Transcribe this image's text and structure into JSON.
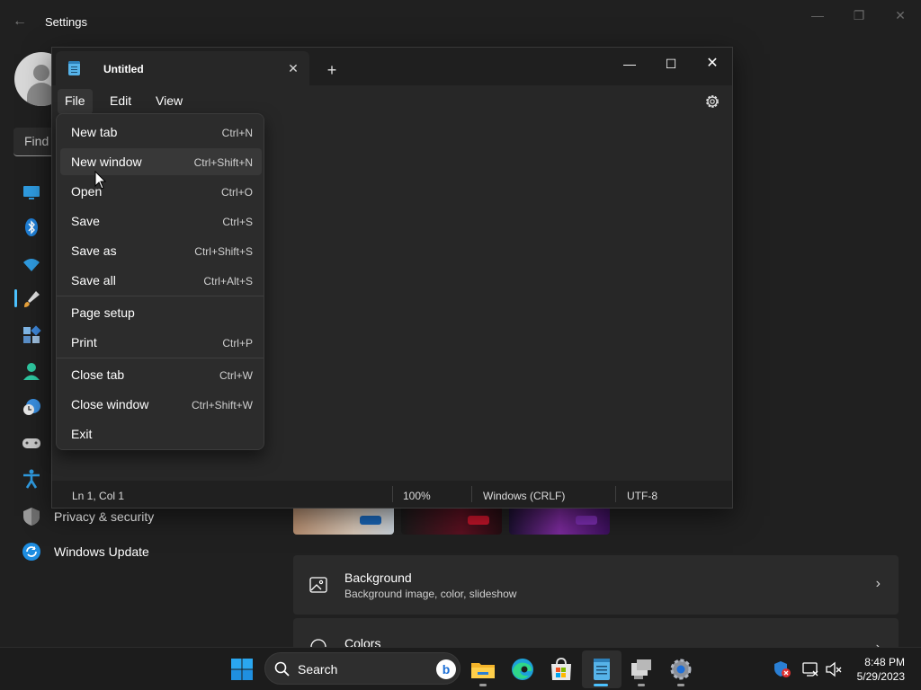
{
  "settings": {
    "title": "Settings",
    "search_placeholder": "Find",
    "nav": [
      {
        "label": "Privacy & security",
        "icon": "shield-icon"
      },
      {
        "label": "Windows Update",
        "icon": "windows-update-icon"
      }
    ],
    "cards": [
      {
        "title": "Background",
        "subtitle": "Background image, color, slideshow",
        "icon": "picture-icon"
      },
      {
        "title": "Colors",
        "subtitle": "",
        "icon": "palette-icon"
      }
    ]
  },
  "notepad": {
    "tab_title": "Untitled",
    "new_tab_glyph": "+",
    "menus": [
      "File",
      "Edit",
      "View"
    ],
    "active_menu": "File",
    "file_menu": [
      {
        "label": "New tab",
        "shortcut": "Ctrl+N"
      },
      {
        "label": "New window",
        "shortcut": "Ctrl+Shift+N"
      },
      {
        "label": "Open",
        "shortcut": "Ctrl+O"
      },
      {
        "label": "Save",
        "shortcut": "Ctrl+S"
      },
      {
        "label": "Save as",
        "shortcut": "Ctrl+Shift+S"
      },
      {
        "label": "Save all",
        "shortcut": "Ctrl+Alt+S"
      },
      {
        "label": "Page setup",
        "shortcut": ""
      },
      {
        "label": "Print",
        "shortcut": "Ctrl+P"
      },
      {
        "label": "Close tab",
        "shortcut": "Ctrl+W"
      },
      {
        "label": "Close window",
        "shortcut": "Ctrl+Shift+W"
      },
      {
        "label": "Exit",
        "shortcut": ""
      }
    ],
    "hovered_item": "New window",
    "status": {
      "position": "Ln 1, Col 1",
      "zoom": "100%",
      "line_ending": "Windows (CRLF)",
      "encoding": "UTF-8"
    }
  },
  "taskbar": {
    "search_label": "Search",
    "pinned": [
      "start-icon",
      "search",
      "file-explorer-icon",
      "edge-icon",
      "store-icon",
      "notepad-icon",
      "remote-desktop-icon",
      "settings-icon"
    ],
    "time": "8:48 PM",
    "date": "5/29/2023"
  },
  "colors": {
    "accent": "#4cc2ff",
    "background": "#202020",
    "menu_bg": "#2c2c2c"
  }
}
